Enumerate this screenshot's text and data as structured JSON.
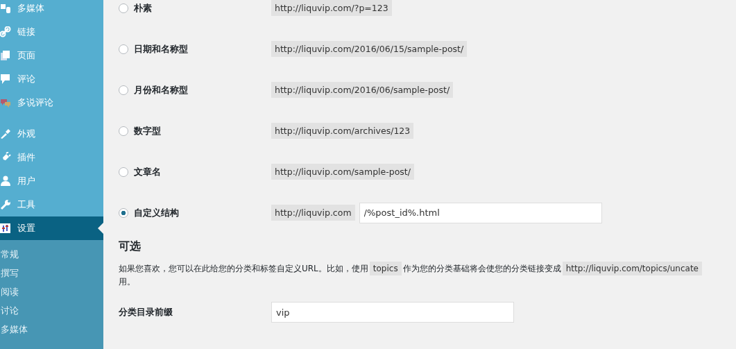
{
  "sidebar": {
    "items": [
      {
        "label": "多媒体",
        "selected": false
      },
      {
        "label": "链接",
        "selected": false
      },
      {
        "label": "页面",
        "selected": false
      },
      {
        "label": "评论",
        "selected": false
      },
      {
        "label": "多说评论",
        "selected": false
      },
      {
        "label": "外观",
        "selected": false
      },
      {
        "label": "插件",
        "selected": false
      },
      {
        "label": "用户",
        "selected": false
      },
      {
        "label": "工具",
        "selected": false
      },
      {
        "label": "设置",
        "selected": true
      }
    ],
    "submenu": [
      {
        "label": "常规"
      },
      {
        "label": "撰写"
      },
      {
        "label": "阅读"
      },
      {
        "label": "讨论"
      },
      {
        "label": "多媒体"
      }
    ]
  },
  "permalink_options": [
    {
      "label": "朴素",
      "example": "http://liquvip.com/?p=123",
      "selected": false
    },
    {
      "label": "日期和名称型",
      "example": "http://liquvip.com/2016/06/15/sample-post/",
      "selected": false
    },
    {
      "label": "月份和名称型",
      "example": "http://liquvip.com/2016/06/sample-post/",
      "selected": false
    },
    {
      "label": "数字型",
      "example": "http://liquvip.com/archives/123",
      "selected": false
    },
    {
      "label": "文章名",
      "example": "http://liquvip.com/sample-post/",
      "selected": false
    },
    {
      "label": "自定义结构",
      "example": "http://liquvip.com",
      "value": "/%post_id%.html",
      "selected": true
    }
  ],
  "optional": {
    "title": "可选",
    "description": {
      "text_1": "如果您喜欢，您可以在此给您的分类和标签自定义URL。比如，使用",
      "code_1": "topics",
      "text_2": "作为您的分类基础将会使您的分类链接变成",
      "code_2": "http://liquvip.com/topics/uncate",
      "text_3": "用。"
    },
    "fields": [
      {
        "label": "分类目录前缀",
        "value": "vip"
      }
    ]
  }
}
